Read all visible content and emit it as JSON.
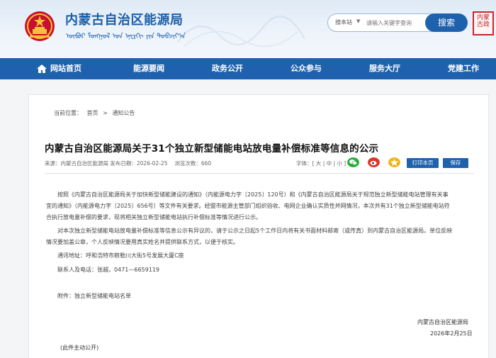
{
  "header": {
    "title": "内蒙古自治区能源局",
    "subtitle": "ᠥᠪᠦᠷ ᠮᠣᠩᠭᠣᠯ ᠤᠨ ᠡᠨᠧᠷᠭᠢ ᠶᠢᠨ ᠲᠣᠪᠴᠢᠶ᠎ᠠ",
    "search_scope": "搜本站",
    "search_placeholder": "请输入关键字查询",
    "search_button": "搜索",
    "seal_text": "内蒙古政"
  },
  "nav": {
    "items": [
      "网站首页",
      "能源要闻",
      "政务公开",
      "公众参与",
      "服务大厅",
      "党建工作"
    ]
  },
  "breadcrumb": {
    "prefix": "当前位置：",
    "home": "首页",
    "sep": ">",
    "section": "通知公告"
  },
  "article": {
    "title": "内蒙古自治区能源局关于31个独立新型储能电站放电量补偿标准等信息的公示",
    "meta": "来源：内蒙古自治区能源局 发布日期：2026-02-25 　浏览次数：660",
    "font_size_label": "字体：[ 大 | 中 | 小 ]",
    "print_button": "打印本页",
    "save_button": "保存",
    "paragraphs": [
      "按照《内蒙古自治区能源局关于加快新型储能建设的通知》（内能源电力字〔2025〕120号）和《内蒙古自治区能源局关于规范独立新型储能电站管理有关事",
      "宜的通知》（内能源电力字〔2025〕656号）等文件有关要求。经盟市能源主管部门组织验收、电网企业确认实质性并网情况，本次共有31个独立新型储能电站符",
      "合执行放电量补偿的要求，现将相关独立新型储能电站执行补偿标准等情况进行公示。",
      "对本次独立新型储能电站放电量补偿标准等信息公示有异议的，请于公示之日起5个工作日内将有关书面材料邮寄（或传真）到内蒙古自治区能源局。单位反映",
      "情况要加盖公章，个人反映情况要用真实姓名并提供联系方式，以便于核实。",
      "通讯地址：呼和浩特市敕勒川大街5号发展大厦C座",
      "联系人及电话：张越，0471—6659119",
      "附件：独立新型储能电站名单"
    ],
    "signature": "内蒙古自治区能源局",
    "date": "2026年2月25日",
    "footnote": "(此件主动公开)"
  },
  "colors": {
    "brand_blue": "#1e62ad",
    "wechat_green": "#2aae3a",
    "weibo_red": "#e2332b",
    "seal_red": "#c62828"
  },
  "icons": [
    "emblem-icon",
    "home-icon",
    "wechat-icon",
    "weibo-icon",
    "qzone-icon",
    "qq-icon"
  ]
}
